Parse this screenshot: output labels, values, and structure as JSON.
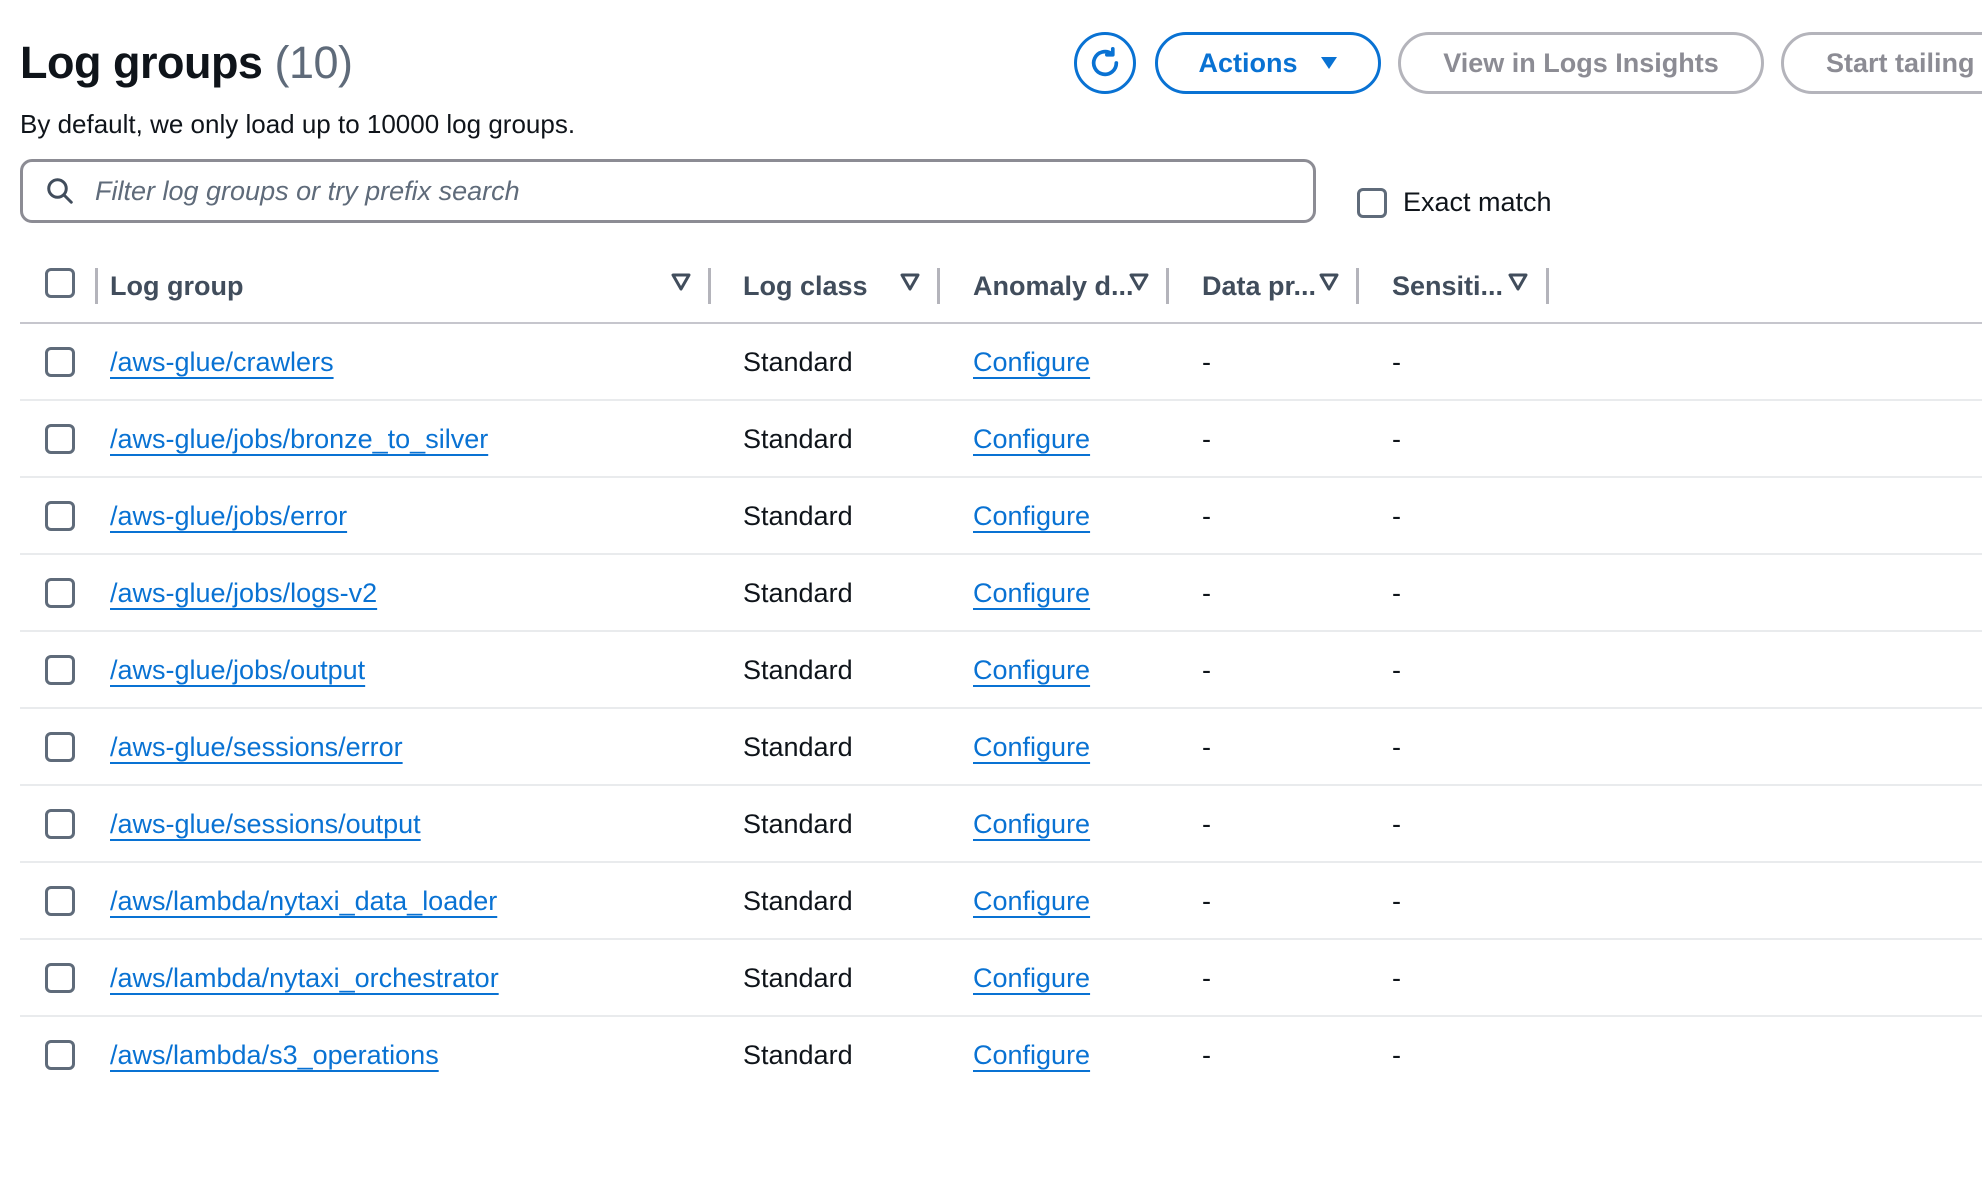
{
  "header": {
    "title": "Log groups",
    "count": "(10)",
    "subtitle": "By default, we only load up to 10000 log groups.",
    "refresh_icon": "refresh-icon",
    "actions_label": "Actions",
    "view_logs_insights_label": "View in Logs Insights",
    "start_tailing_label": "Start tailing"
  },
  "search": {
    "placeholder": "Filter log groups or try prefix search",
    "value": "",
    "icon": "search-icon"
  },
  "exact_match": {
    "label": "Exact match",
    "checked": false
  },
  "table": {
    "columns": [
      {
        "label": "Log group"
      },
      {
        "label": "Log class"
      },
      {
        "label": "Anomaly d..."
      },
      {
        "label": "Data pr..."
      },
      {
        "label": "Sensiti..."
      }
    ],
    "rows": [
      {
        "log_group": "/aws-glue/crawlers",
        "log_class": "Standard",
        "anomaly": "Configure",
        "data_protection": "-",
        "sensitive": "-"
      },
      {
        "log_group": "/aws-glue/jobs/bronze_to_silver",
        "log_class": "Standard",
        "anomaly": "Configure",
        "data_protection": "-",
        "sensitive": "-"
      },
      {
        "log_group": "/aws-glue/jobs/error",
        "log_class": "Standard",
        "anomaly": "Configure",
        "data_protection": "-",
        "sensitive": "-"
      },
      {
        "log_group": "/aws-glue/jobs/logs-v2",
        "log_class": "Standard",
        "anomaly": "Configure",
        "data_protection": "-",
        "sensitive": "-"
      },
      {
        "log_group": "/aws-glue/jobs/output",
        "log_class": "Standard",
        "anomaly": "Configure",
        "data_protection": "-",
        "sensitive": "-"
      },
      {
        "log_group": "/aws-glue/sessions/error",
        "log_class": "Standard",
        "anomaly": "Configure",
        "data_protection": "-",
        "sensitive": "-"
      },
      {
        "log_group": "/aws-glue/sessions/output",
        "log_class": "Standard",
        "anomaly": "Configure",
        "data_protection": "-",
        "sensitive": "-"
      },
      {
        "log_group": "/aws/lambda/nytaxi_data_loader",
        "log_class": "Standard",
        "anomaly": "Configure",
        "data_protection": "-",
        "sensitive": "-"
      },
      {
        "log_group": "/aws/lambda/nytaxi_orchestrator",
        "log_class": "Standard",
        "anomaly": "Configure",
        "data_protection": "-",
        "sensitive": "-"
      },
      {
        "log_group": "/aws/lambda/s3_operations",
        "log_class": "Standard",
        "anomaly": "Configure",
        "data_protection": "-",
        "sensitive": "-"
      }
    ]
  },
  "colors": {
    "accent": "#0972d3",
    "text": "#0f141a",
    "muted": "#5f6b7a",
    "disabled_border": "#b4b4bb"
  }
}
